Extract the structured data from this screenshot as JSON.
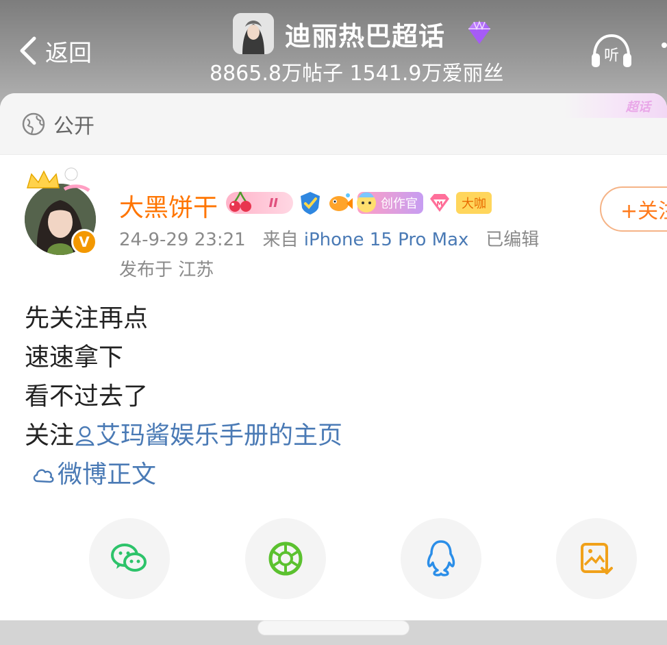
{
  "header": {
    "back_label": "返回",
    "topic_title": "迪丽热巴超话",
    "stats": "8865.8万帖子 1541.9万爱丽丝",
    "listen_label": "听",
    "chaohua_tag": "超话"
  },
  "visibility": {
    "label": "公开"
  },
  "author": {
    "name": "大黑饼干",
    "level_badge": "II",
    "creator_badge": "创作官",
    "daka_badge": "大咖",
    "verified_mark": "V",
    "follow_label": "+关注",
    "timestamp": "24-9-29 23:21",
    "source_prefix": "来自",
    "device": "iPhone 15 Pro Max",
    "edited": "已编辑",
    "location": "发布于 江苏"
  },
  "post": {
    "line1": "先关注再点",
    "line2": "速速拿下",
    "line3": "看不过去了",
    "line4_prefix": "关注",
    "user_link": "艾玛酱娱乐手册的主页",
    "weibo_link": "微博正文"
  },
  "share_targets": [
    "wechat-icon",
    "moments-icon",
    "qq-icon",
    "save-image-icon"
  ],
  "colors": {
    "username": "#ff7500",
    "link": "#4a7ab5",
    "follow_border": "#f5b386"
  }
}
